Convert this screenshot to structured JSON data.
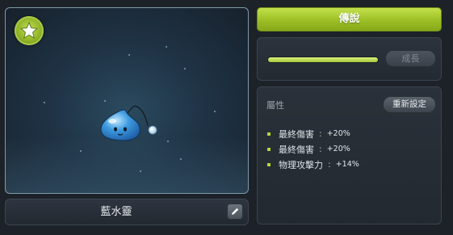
{
  "pet": {
    "name": "藍水靈",
    "grade_label": "傳說",
    "grade_icon": "star-icon",
    "edit_icon": "pencil-icon",
    "growth": {
      "fill_fraction": 1.0
    },
    "grow_button_label": "成長"
  },
  "attributes": {
    "title": "屬性",
    "reset_button_label": "重新設定",
    "items": [
      {
        "name": "最終傷害",
        "separator": ":",
        "value": "+20%"
      },
      {
        "name": "最終傷害",
        "separator": ":",
        "value": "+20%"
      },
      {
        "name": "物理攻擊力",
        "separator": ":",
        "value": "+14%"
      }
    ]
  },
  "colors": {
    "accent_green": "#9cbf25",
    "panel_bg": "#242a32",
    "text_light": "#dde2e6"
  }
}
